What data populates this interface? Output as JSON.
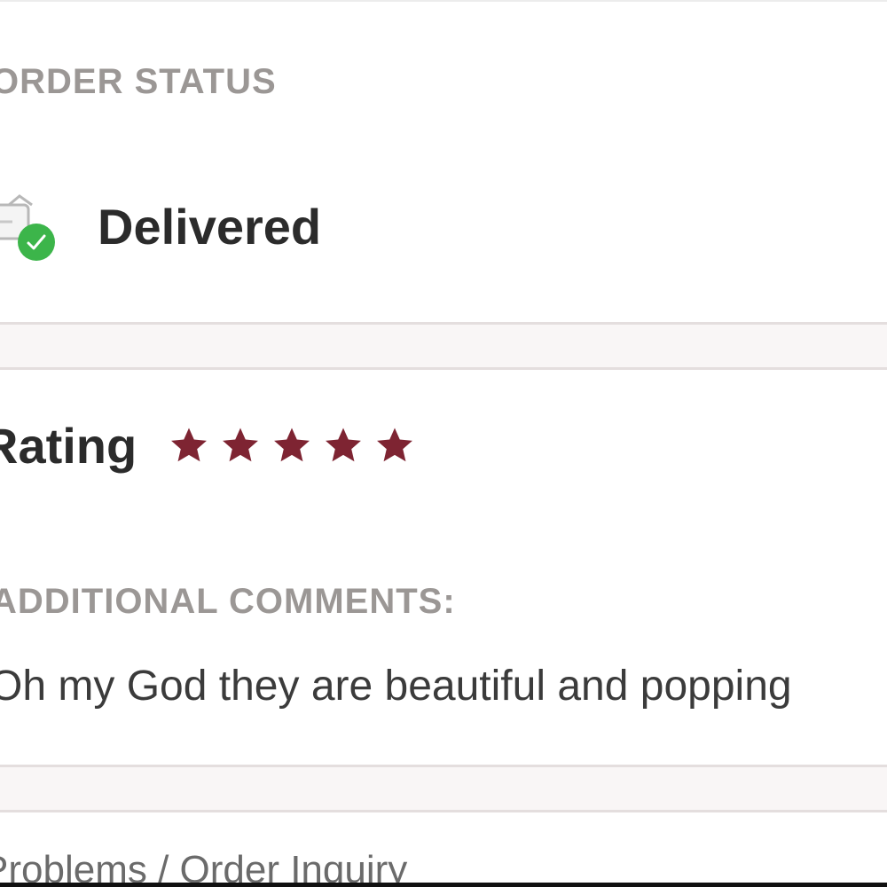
{
  "order_status": {
    "section_label": "ORDER STATUS",
    "status_text": "Delivered",
    "status_icon": "delivery-truck-check-icon",
    "check_color": "#3cb54a"
  },
  "rating": {
    "label": "Rating",
    "stars": 5,
    "max_stars": 5,
    "star_color": "#7e2432"
  },
  "comments": {
    "section_label": "ADDITIONAL COMMENTS:",
    "text": "Oh my God they are beautiful and popping"
  },
  "footer": {
    "link_text": "Problems / Order Inquiry"
  }
}
